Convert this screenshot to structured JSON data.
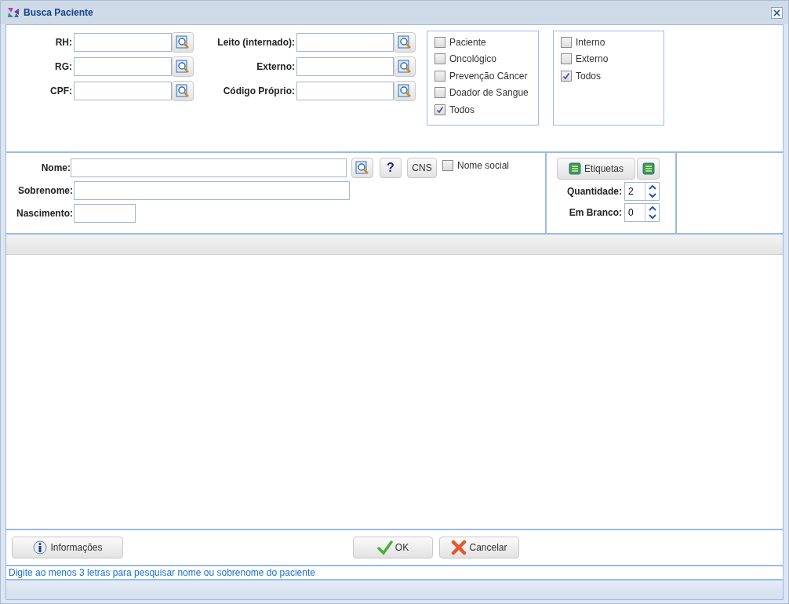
{
  "window": {
    "title": "Busca Paciente"
  },
  "id_fields_left": [
    {
      "label": "RH:"
    },
    {
      "label": "RG:"
    },
    {
      "label": "CPF:"
    }
  ],
  "id_fields_right": [
    {
      "label": "Leito (internado):"
    },
    {
      "label": "Externo:"
    },
    {
      "label": "Código Próprio:"
    }
  ],
  "filter_type": [
    {
      "label": "Paciente",
      "checked": false
    },
    {
      "label": "Oncológico",
      "checked": false
    },
    {
      "label": "Prevenção Câncer",
      "checked": false
    },
    {
      "label": "Doador de Sangue",
      "checked": false
    },
    {
      "label": "Todos",
      "checked": true
    }
  ],
  "filter_origin": [
    {
      "label": "Interno",
      "checked": false
    },
    {
      "label": "Externo",
      "checked": false
    },
    {
      "label": "Todos",
      "checked": true
    }
  ],
  "name_section": {
    "name_label": "Nome:",
    "surname_label": "Sobrenome:",
    "birth_label": "Nascimento:",
    "help_button": "?",
    "cns_button": "CNS",
    "social_name": {
      "label": "Nome social",
      "checked": false
    }
  },
  "labels_panel": {
    "button": "Etiquetas",
    "quantity": {
      "label": "Quantidade:",
      "value": "2"
    },
    "blank": {
      "label": "Em Branco:",
      "value": "0"
    }
  },
  "buttons": [
    {
      "kind": "info",
      "label": "Informações"
    },
    {
      "kind": "ok",
      "label": "OK"
    },
    {
      "kind": "cancel",
      "label": "Cancelar"
    }
  ],
  "status_message": "Digite ao menos 3 letras para pesquisar nome ou sobrenome do paciente"
}
